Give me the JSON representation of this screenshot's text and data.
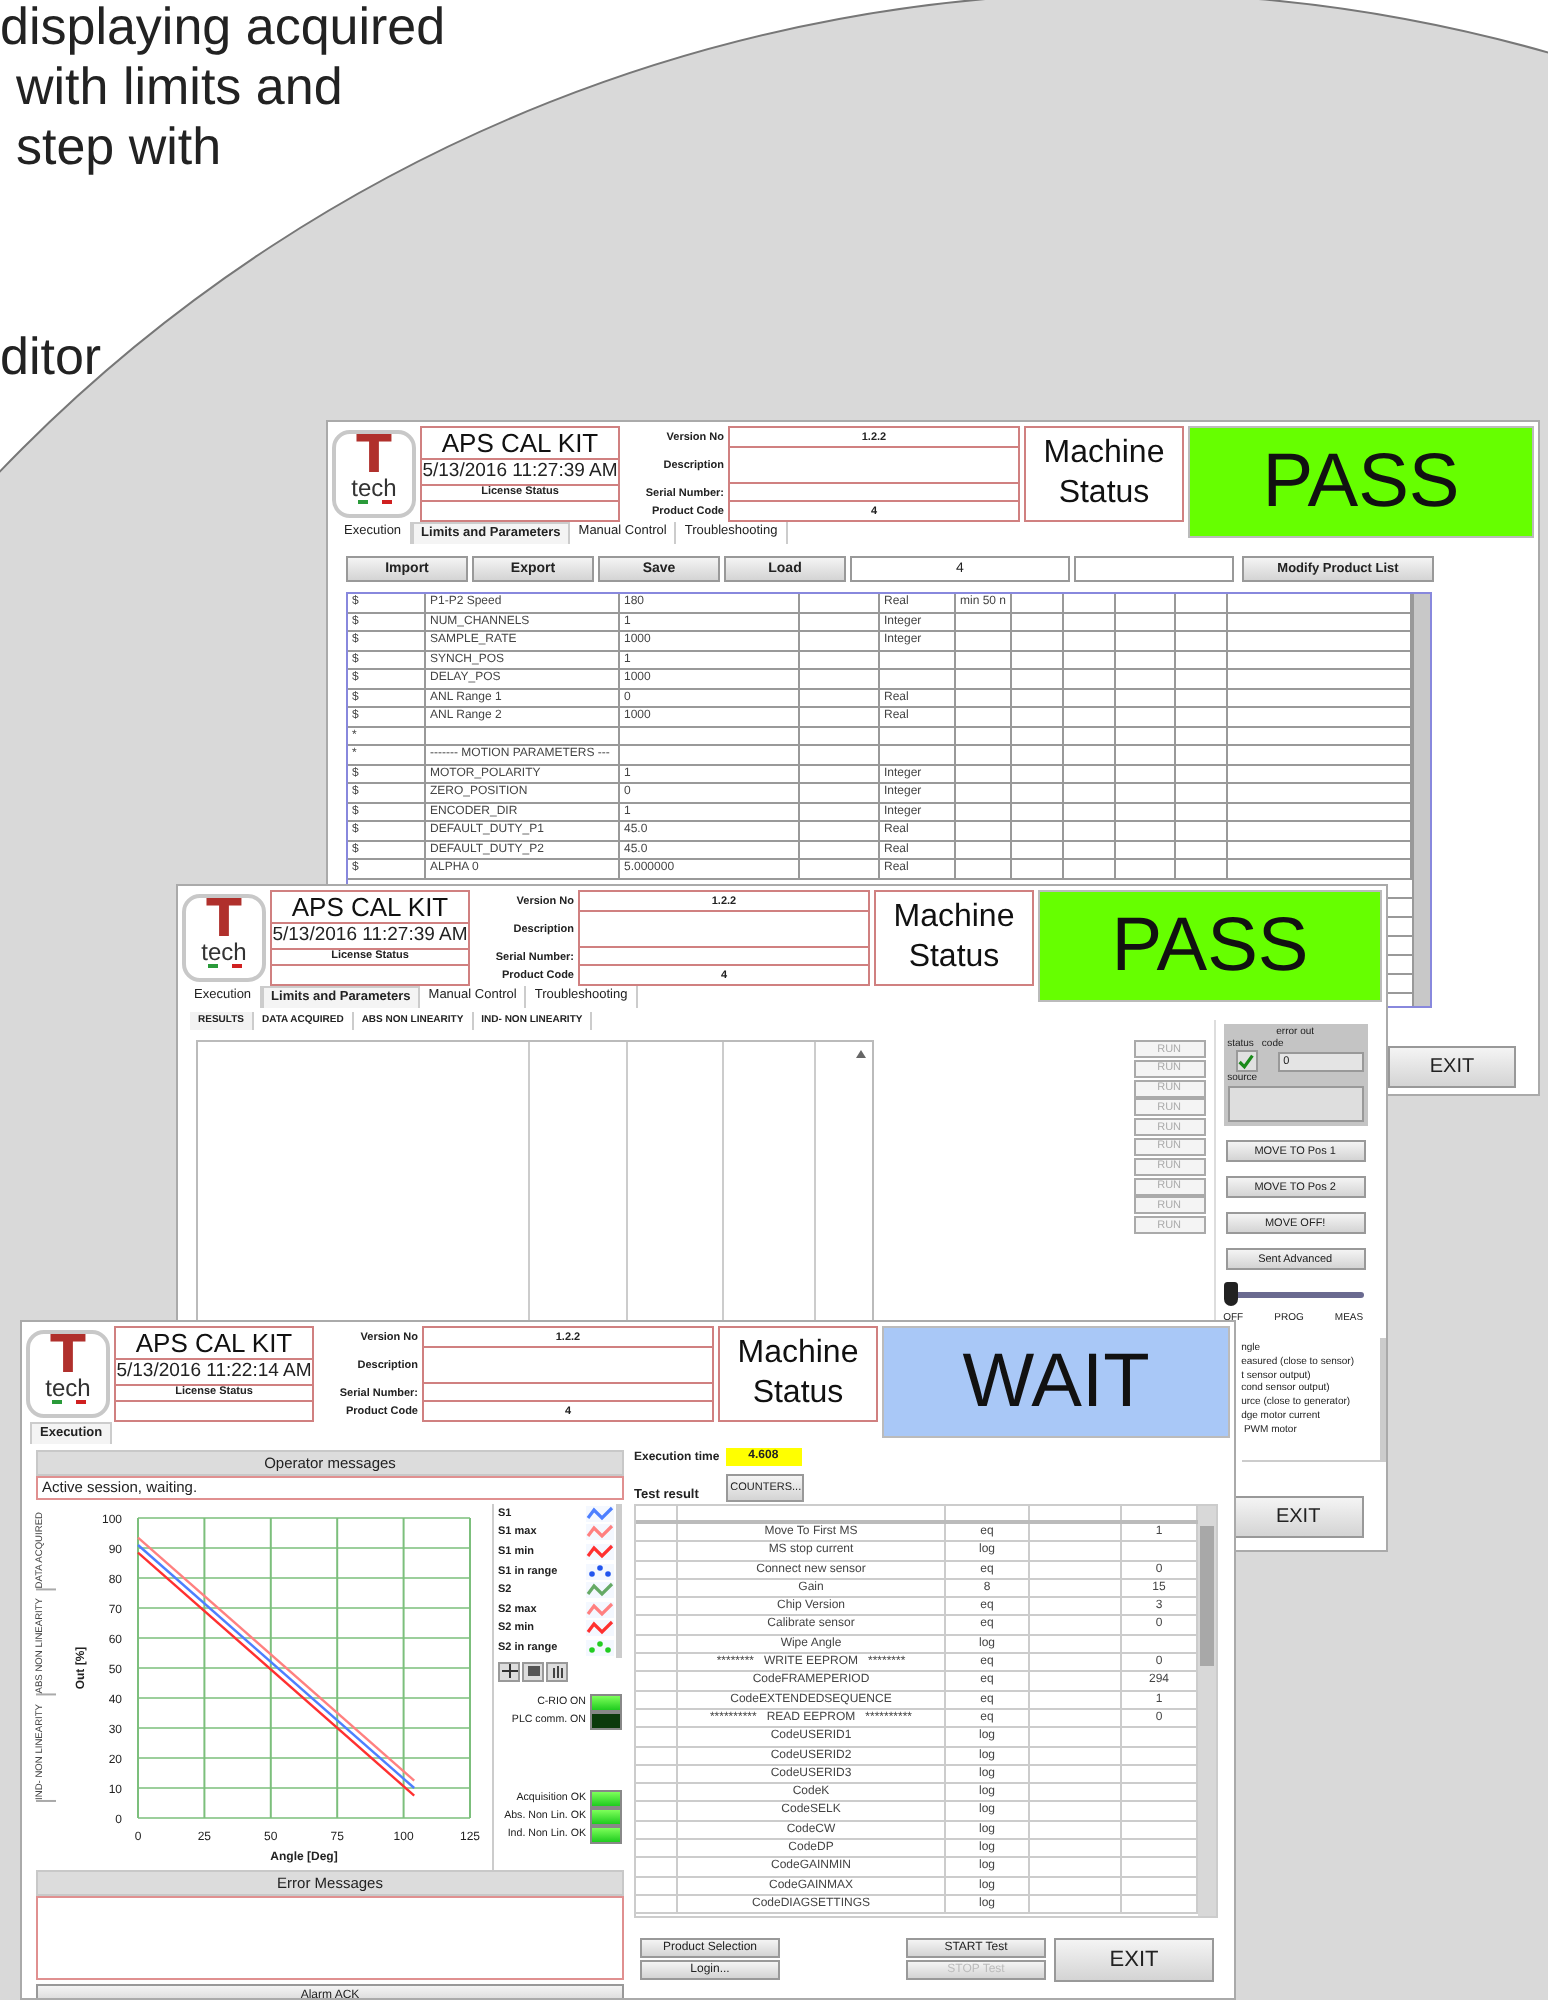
{
  "slide_text": [
    "displaying acquired",
    "with limits and",
    "step with",
    "ditor"
  ],
  "windows": [
    {
      "kind": "parameters",
      "logo": {
        "mark": "T",
        "text": "tech"
      },
      "title": "APS CAL KIT",
      "datetime": "5/13/2016 11:27:39 AM",
      "license_label": "License Status",
      "fields": [
        {
          "label": "Version No",
          "value": "1.2.2"
        },
        {
          "label": "Description"
        },
        {
          "label": "Serial Number:"
        },
        {
          "label": "Product Code",
          "value": "4"
        }
      ],
      "machine_status_label": "Machine Status",
      "status": {
        "text": "PASS",
        "color": "#66ff00"
      },
      "tabs": [
        {
          "label": "Execution",
          "selected": false
        },
        {
          "label": "Limits and Parameters",
          "selected": true
        },
        {
          "label": "Manual Control",
          "selected": false
        },
        {
          "label": "Troubleshooting",
          "selected": false
        }
      ],
      "toolbar": {
        "buttons": [
          "Import",
          "Export",
          "Save",
          "Load"
        ],
        "product_field": "4",
        "action_button": "Modify Product List"
      },
      "table": {
        "rows": [
          {
            "column_1": "$",
            "column_2": "P1-P2 Speed",
            "column_3": "180",
            "column_5": "Real",
            "column_6": "min 50 n"
          },
          {
            "column_1": "$",
            "column_2": "NUM_CHANNELS",
            "column_3": "1",
            "column_5": "Integer"
          },
          {
            "column_1": "$",
            "column_2": "SAMPLE_RATE",
            "column_3": "1000",
            "column_5": "Integer"
          },
          {
            "column_1": "$",
            "column_2": "SYNCH_POS",
            "column_3": "1"
          },
          {
            "column_1": "$",
            "column_2": "DELAY_POS",
            "column_3": "1000"
          },
          {
            "column_1": "$",
            "column_2": "ANL Range 1",
            "column_3": "0",
            "column_5": "Real"
          },
          {
            "column_1": "$",
            "column_2": "ANL Range 2",
            "column_3": "1000",
            "column_5": "Real"
          },
          {
            "column_1": "*"
          },
          {
            "column_1": "*",
            "column_2": "------- MOTION PARAMETERS ---"
          },
          {
            "column_1": "$",
            "column_2": "MOTOR_POLARITY",
            "column_3": "1",
            "column_5": "Integer"
          },
          {
            "column_1": "$",
            "column_2": "ZERO_POSITION",
            "column_3": "0",
            "column_5": "Integer"
          },
          {
            "column_1": "$",
            "column_2": "ENCODER_DIR",
            "column_3": "1",
            "column_5": "Integer"
          },
          {
            "column_1": "$",
            "column_2": "DEFAULT_DUTY_P1",
            "column_3": "45.0",
            "column_5": "Real"
          },
          {
            "column_1": "$",
            "column_2": "DEFAULT_DUTY_P2",
            "column_3": "45.0",
            "column_5": "Real"
          },
          {
            "column_1": "$",
            "column_2": "ALPHA 0",
            "column_3": "5.000000",
            "column_5": "Real"
          }
        ]
      },
      "exit_button": "EXIT"
    },
    {
      "kind": "results",
      "logo": {
        "mark": "T",
        "text": "tech"
      },
      "title": "APS CAL KIT",
      "datetime": "5/13/2016 11:27:39 AM",
      "license_label": "License Status",
      "fields": [
        {
          "label": "Version No",
          "value": "1.2.2"
        },
        {
          "label": "Description"
        },
        {
          "label": "Serial Number:"
        },
        {
          "label": "Product Code",
          "value": "4"
        }
      ],
      "machine_status_label": "Machine Status",
      "status": {
        "text": "PASS",
        "color": "#66ff00"
      },
      "tabs": [
        {
          "label": "Execution",
          "selected": false
        },
        {
          "label": "Limits and Parameters",
          "selected": true
        },
        {
          "label": "Manual Control",
          "selected": false
        },
        {
          "label": "Troubleshooting",
          "selected": false
        }
      ],
      "subtabs": [
        {
          "label": "RESULTS",
          "selected": true
        },
        {
          "label": "DATA ACQUIRED",
          "selected": false
        },
        {
          "label": "ABS NON LINEARITY",
          "selected": false
        },
        {
          "label": "IND- NON LINEARITY",
          "selected": false
        }
      ],
      "run_buttons": [
        {
          "label": "RUN",
          "disabled": true
        },
        {
          "label": "RUN",
          "disabled": true
        },
        {
          "label": "RUN",
          "disabled": true
        },
        {
          "label": "RUN",
          "disabled": true
        },
        {
          "label": "RUN",
          "disabled": true
        },
        {
          "label": "RUN",
          "disabled": true
        },
        {
          "label": "RUN",
          "disabled": true
        },
        {
          "label": "RUN",
          "disabled": true
        },
        {
          "label": "RUN",
          "disabled": true
        },
        {
          "label": "RUN",
          "disabled": true
        }
      ],
      "error_out": {
        "title": "error out",
        "status_label": "status",
        "checked": true,
        "code_label": "code",
        "code": "0",
        "source_label": "source"
      },
      "move_buttons": [
        "MOVE TO Pos 1",
        "MOVE TO Pos 2",
        "MOVE OFF!",
        "Sent Advanced"
      ],
      "mode_slider": {
        "level": 0,
        "labels": [
          "OFF",
          "PROG",
          "MEAS"
        ]
      },
      "legend_lines": [
        "ngle",
        "easured (close to sensor)",
        "t sensor output)",
        "cond sensor output)",
        "urce (close to generator)",
        "dge motor current",
        " PWM motor"
      ],
      "exit_button": "EXIT"
    },
    {
      "kind": "execution",
      "logo": {
        "mark": "T",
        "text": "tech"
      },
      "title": "APS CAL KIT",
      "datetime": "5/13/2016 11:22:14 AM",
      "license_label": "License Status",
      "fields": [
        {
          "label": "Version No",
          "value": "1.2.2"
        },
        {
          "label": "Description"
        },
        {
          "label": "Serial Number:"
        },
        {
          "label": "Product Code",
          "value": "4"
        }
      ],
      "machine_status_label": "Machine Status",
      "status": {
        "text": "WAIT",
        "color": "#a9c8f7"
      },
      "tabs": [
        {
          "label": "Execution",
          "selected": true
        }
      ],
      "operator_messages": {
        "title": "Operator messages",
        "message": "Active session, waiting."
      },
      "side_tabs": [
        "DATA ACQUIRED",
        "ABS NON LINEARITY",
        "IND- NON LINEARITY"
      ],
      "chart_data": {
        "type": "line",
        "xlabel": "Angle [Deg]",
        "ylabel": "Out [%]",
        "x": [
          0,
          104
        ],
        "xlim": [
          0,
          125
        ],
        "ylim": [
          0,
          100
        ],
        "xticks": [
          0,
          25,
          50,
          75,
          100,
          125
        ],
        "yticks": [
          0,
          10,
          20,
          30,
          40,
          50,
          60,
          70,
          80,
          90,
          100
        ],
        "grid": true,
        "series": [
          {
            "name": "S1",
            "color": "#4d7fff",
            "values": [
              91,
              10
            ]
          },
          {
            "name": "S1 max",
            "color": "#ff8080",
            "values": [
              93.5,
              12.5
            ]
          },
          {
            "name": "S1 min",
            "color": "#ff3030",
            "values": [
              88.5,
              7.5
            ]
          }
        ]
      },
      "legend": [
        {
          "kind": "series"
        },
        {
          "kind": "series"
        },
        {
          "kind": "series"
        },
        {
          "kind": "points",
          "label": "S1 in range",
          "color": "#2255ee"
        },
        {
          "kind": "line",
          "label": "S2",
          "color": "#66aa66"
        },
        {
          "kind": "line",
          "label": "S2 max",
          "color": "#ff8080"
        },
        {
          "kind": "line",
          "label": "S2 min",
          "color": "#ff3030"
        },
        {
          "kind": "points",
          "label": "S2 in range",
          "color": "#22cc22"
        }
      ],
      "indicators": [
        {
          "label": "C-RIO ON",
          "on": true
        },
        {
          "label": "PLC comm. ON",
          "on": false
        }
      ],
      "checks": [
        {
          "label": "Acquisition OK",
          "on": true
        },
        {
          "label": "Abs. Non Lin. OK",
          "on": true
        },
        {
          "label": "Ind. Non Lin. OK",
          "on": true
        }
      ],
      "error_messages_title": "Error Messages",
      "alarm_button": "Alarm ACK",
      "execution_time": {
        "label": "Execution time",
        "value": "4.608"
      },
      "test_result_label": "Test result",
      "counters_button": "COUNTERS...",
      "results": [
        {
          "column_2": "Move To First MS",
          "column_3": "eq",
          "column_5": "1"
        },
        {
          "column_2": "MS stop current",
          "column_3": "log"
        },
        {
          "column_2": "Connect new sensor",
          "column_3": "eq",
          "column_5": "0"
        },
        {
          "column_2": "Gain",
          "column_3": "8",
          "column_5": "15"
        },
        {
          "column_2": "Chip Version",
          "column_3": "eq",
          "column_5": "3"
        },
        {
          "column_2": "Calibrate sensor",
          "column_3": "eq",
          "column_5": "0"
        },
        {
          "column_2": "Wipe Angle",
          "column_3": "log"
        },
        {
          "column_2": "********   WRITE EEPROM   ********",
          "column_3": "eq",
          "column_5": "0"
        },
        {
          "column_2": "CodeFRAMEPERIOD",
          "column_3": "eq",
          "column_5": "294"
        },
        {
          "column_2": "CodeEXTENDEDSEQUENCE",
          "column_3": "eq",
          "column_5": "1"
        },
        {
          "column_2": "**********   READ EEPROM   **********",
          "column_3": "eq",
          "column_5": "0"
        },
        {
          "column_2": "CodeUSERID1",
          "column_3": "log"
        },
        {
          "column_2": "CodeUSERID2",
          "column_3": "log"
        },
        {
          "column_2": "CodeUSERID3",
          "column_3": "log"
        },
        {
          "column_2": "CodeK",
          "column_3": "log"
        },
        {
          "column_2": "CodeSELK",
          "column_3": "log"
        },
        {
          "column_2": "CodeCW",
          "column_3": "log"
        },
        {
          "column_2": "CodeDP",
          "column_3": "log"
        },
        {
          "column_2": "CodeGAINMIN",
          "column_3": "log"
        },
        {
          "column_2": "CodeGAINMAX",
          "column_3": "log"
        },
        {
          "column_2": "CodeDIAGSETTINGS",
          "column_3": "log"
        }
      ],
      "left_buttons": [
        {
          "label": "Product Selection",
          "disabled": false
        },
        {
          "label": "Login...",
          "disabled": false
        }
      ],
      "test_buttons": [
        {
          "label": "START Test",
          "disabled": false
        },
        {
          "label": "STOP Test",
          "disabled": true
        }
      ],
      "exit_button": "EXIT"
    }
  ]
}
